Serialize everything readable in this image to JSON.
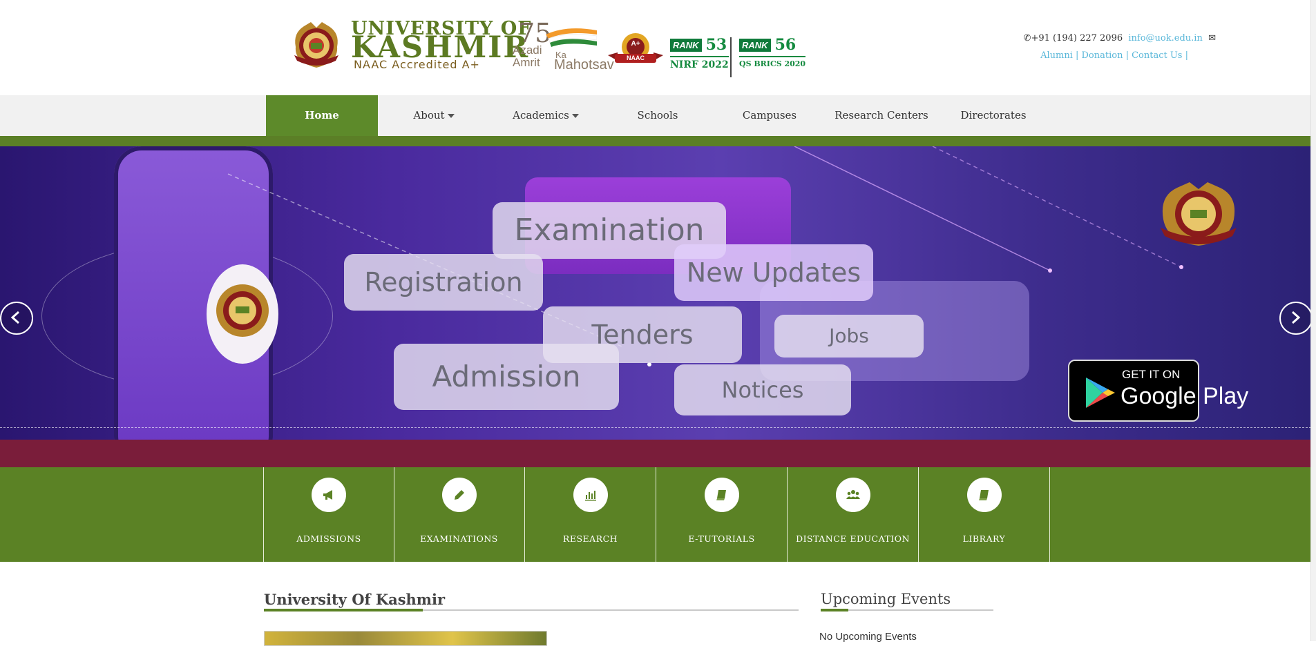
{
  "header": {
    "university_line1": "UNIVERSITY OF",
    "university_line2": "KASHMIR",
    "university_line3": "NAAC Accredited A+",
    "azadi": {
      "n75": "75",
      "line1": "Azadi",
      "line2": "Amrit",
      "ka": "Ka",
      "mahotsav": "Mahotsav"
    },
    "naac_badge": {
      "grade": "A+",
      "label": "NAAC"
    },
    "ranks": [
      {
        "badge": "RANK",
        "number": "53",
        "label": "NIRF 2022"
      },
      {
        "badge": "RANK",
        "number": "56",
        "label": "QS BRICS 2020"
      }
    ],
    "phone": "+91 (194) 227 2096",
    "email": "info@uok.edu.in",
    "links": "Alumni | Donation | Contact Us |"
  },
  "nav": {
    "items": [
      {
        "label": "Home",
        "active": true
      },
      {
        "label": "About",
        "dropdown": true
      },
      {
        "label": "Academics",
        "dropdown": true
      },
      {
        "label": "Schools"
      },
      {
        "label": "Campuses"
      },
      {
        "label": "Research Centers"
      },
      {
        "label": "Directorates"
      }
    ]
  },
  "banner": {
    "bubbles": [
      "Examination",
      "Registration",
      "New Updates",
      "Tenders",
      "Jobs",
      "Admission",
      "Notices"
    ],
    "google_play": {
      "line1": "GET IT ON",
      "line2": "Google Play"
    }
  },
  "quick_links": [
    {
      "label": "ADMISSIONS",
      "icon": "megaphone-icon"
    },
    {
      "label": "EXAMINATIONS",
      "icon": "pencil-icon"
    },
    {
      "label": "RESEARCH",
      "icon": "bar-chart-icon"
    },
    {
      "label": "E-TUTORIALS",
      "icon": "book-icon"
    },
    {
      "label": "DISTANCE EDUCATION",
      "icon": "users-icon"
    },
    {
      "label": "LIBRARY",
      "icon": "library-book-icon"
    }
  ],
  "main": {
    "title": "University Of Kashmir"
  },
  "events": {
    "title": "Upcoming Events",
    "empty_text": "No Upcoming Events"
  },
  "colors": {
    "brand_green": "#5b8225",
    "link_blue": "#59b7d9",
    "rank_green": "#148a3f",
    "banner_maroon": "#7a1d3a"
  }
}
